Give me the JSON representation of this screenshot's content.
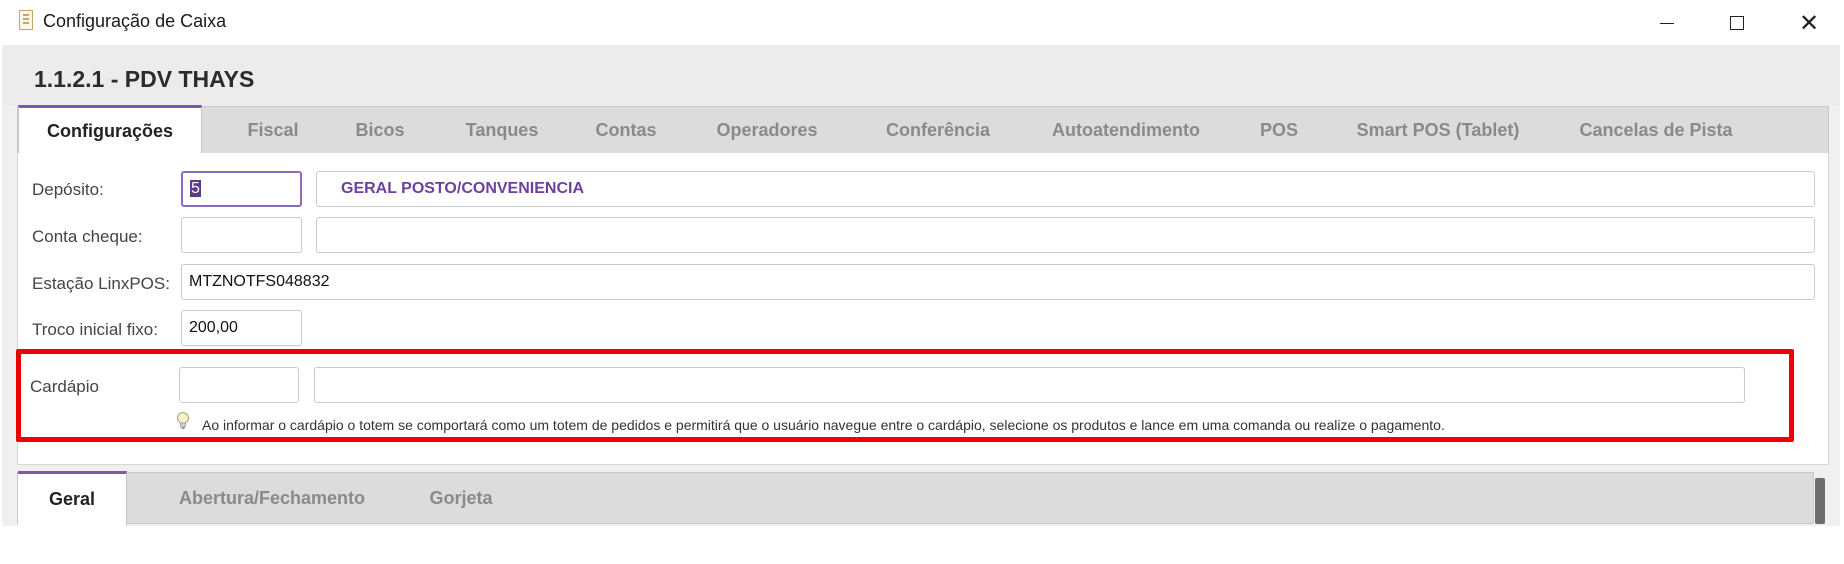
{
  "window": {
    "title": "Configuração de Caixa",
    "icon": "document-icon",
    "controls": [
      "minimize-icon",
      "maximize-icon",
      "close-icon"
    ]
  },
  "header": {
    "record_title": "1.1.2.1 - PDV THAYS"
  },
  "tabs": [
    {
      "label": "Configurações",
      "active": true
    },
    {
      "label": "Fiscal"
    },
    {
      "label": "Bicos"
    },
    {
      "label": "Tanques"
    },
    {
      "label": "Contas"
    },
    {
      "label": "Operadores"
    },
    {
      "label": "Conferência"
    },
    {
      "label": "Autoatendimento"
    },
    {
      "label": "POS"
    },
    {
      "label": "Smart POS (Tablet)"
    },
    {
      "label": "Cancelas de Pista"
    }
  ],
  "form": {
    "deposito": {
      "label": "Depósito:",
      "code": "5",
      "description": "GERAL POSTO/CONVENIENCIA"
    },
    "conta_cheque": {
      "label": "Conta cheque:",
      "code": "",
      "description": ""
    },
    "estacao": {
      "label": "Estação LinxPOS:",
      "value": "MTZNOTFS048832"
    },
    "troco": {
      "label": "Troco inicial fixo:",
      "value": "200,00"
    },
    "cardapio": {
      "label": "Cardápio",
      "code": "",
      "description": "",
      "hint": "Ao informar o cardápio o totem se comportará como um totem de pedidos e permitirá que o usuário navegue entre o cardápio, selecione os produtos e lance em uma comanda ou realize o pagamento."
    }
  },
  "subtabs": [
    {
      "label": "Geral",
      "active": true
    },
    {
      "label": "Abertura/Fechamento"
    },
    {
      "label": "Gorjeta"
    }
  ],
  "colors": {
    "accent": "#7d5aa6",
    "description_text": "#6e3f9e",
    "highlight": "#ee0000"
  }
}
